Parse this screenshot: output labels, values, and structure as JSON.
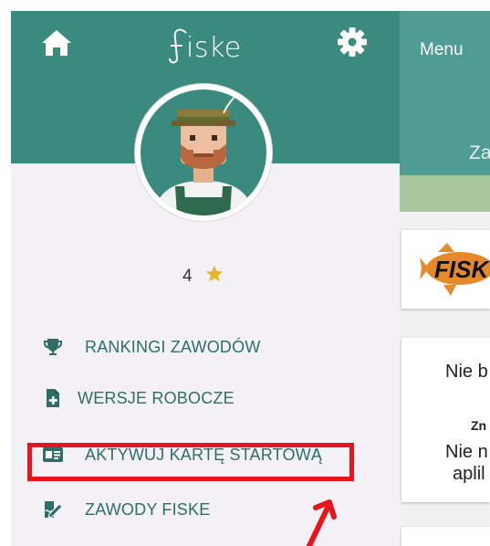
{
  "app": {
    "logo_text": "iske",
    "brand_color": "#3a8a80",
    "icons": {
      "home": "home-icon",
      "settings": "gear-icon"
    }
  },
  "profile": {
    "rating": "4",
    "rating_icon": "star-icon",
    "star_color": "#e9b531"
  },
  "menu": {
    "items": [
      {
        "label": "RANKINGI ZAWODÓW",
        "icon": "trophy-icon"
      },
      {
        "label": "WERSJE ROBOCZE",
        "icon": "document-plus-icon"
      },
      {
        "label": "AKTYWUJ KARTĘ STARTOWĄ",
        "icon": "id-card-icon"
      },
      {
        "label": "ZAWODY FISKE",
        "icon": "edit-signature-icon"
      }
    ],
    "label_color": "#2e6e68"
  },
  "annotation": {
    "highlight_color": "#e8141b"
  },
  "background_page": {
    "menu_label": "Menu",
    "header_partial": "Za",
    "logo_partial": "FISK",
    "message_lines": [
      "Nie b",
      "Zn",
      "Nie n",
      "aplil"
    ]
  }
}
